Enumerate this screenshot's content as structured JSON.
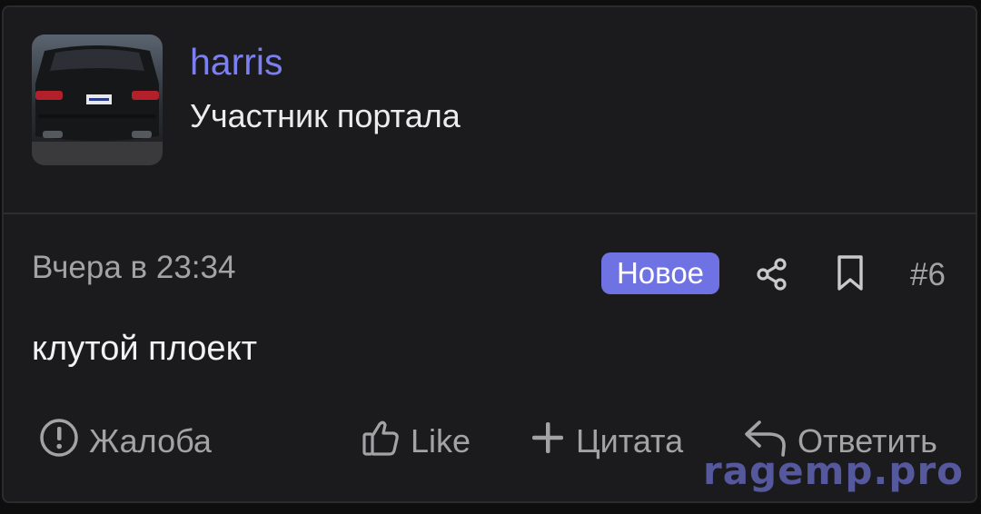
{
  "author": {
    "username": "harris",
    "title": "Участник портала",
    "avatar_icon": "car-photo-avatar"
  },
  "post": {
    "date": "Вчера в 23:34",
    "badge": "Новое",
    "number": "#6",
    "body": "клутой плоект"
  },
  "actions": {
    "report": "Жалоба",
    "like": "Like",
    "quote": "Цитата",
    "reply": "Ответить"
  },
  "icons": {
    "share": "share-icon",
    "bookmark": "bookmark-icon",
    "report": "exclamation-circle-icon",
    "like": "thumbs-up-icon",
    "quote": "plus-icon",
    "reply": "reply-arrow-icon"
  },
  "watermark": "ragemp.pro",
  "colors": {
    "accent": "#7b7ff0",
    "badge_bg": "#6f72e3",
    "card_bg": "#1b1b1d",
    "muted_text": "#a3a3a6"
  }
}
